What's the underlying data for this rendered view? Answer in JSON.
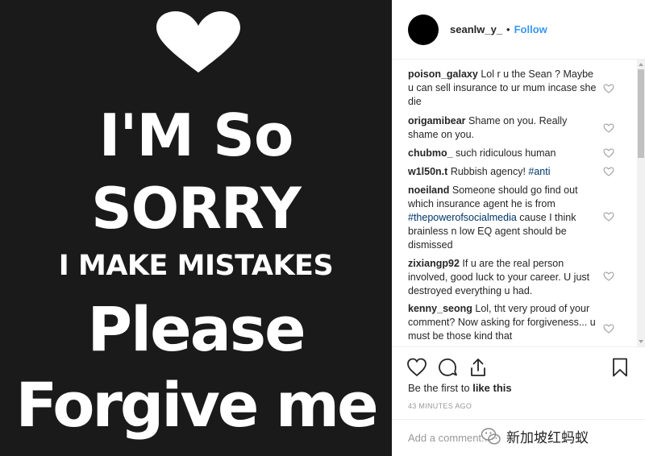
{
  "photo": {
    "lines": [
      "I'M So",
      "SORRY",
      "I MAKE MISTAKES",
      "Please",
      "Forgive me"
    ]
  },
  "header": {
    "username": "seanlw_y_",
    "separator": "•",
    "follow_label": "Follow"
  },
  "comments": [
    {
      "user": "poison_galaxy",
      "text": "Lol r u the Sean ? Maybe u can sell insurance to ur mum incase she die"
    },
    {
      "user": "origamibear",
      "text": "Shame on you. Really shame on you."
    },
    {
      "user": "chubmo_",
      "text": "such ridiculous human"
    },
    {
      "user": "w1l50n.t",
      "text": "Rubbish agency! ",
      "tag": "#anti"
    },
    {
      "user": "noeiland",
      "text": "Someone should go find out which insurance agent he is from ",
      "tag": "#thepowerofsocialmedia",
      "text_after": " cause I think brainless n low EQ agent should be dismissed"
    },
    {
      "user": "zixiangp92",
      "text": "If u are the real person involved, good luck to your career. U just destroyed everything u had."
    },
    {
      "user": "kenny_seong",
      "text": "Lol, tht very proud of your comment? Now asking for forgiveness... u must be those kind that"
    }
  ],
  "likes": {
    "prefix": "Be the first to ",
    "action": "like this"
  },
  "timestamp": "43 MINUTES AGO",
  "add_comment": {
    "placeholder": "Add a comment..."
  },
  "watermark": {
    "text": "新加坡红蚂蚁"
  },
  "icons": {
    "like": "heart-icon",
    "comment": "comment-icon",
    "share": "share-icon",
    "save": "bookmark-icon",
    "comment_like": "heart-outline-icon",
    "watermark": "wechat-icon"
  },
  "colors": {
    "photo_bg": "#1b1a1a",
    "follow": "#3897f0",
    "hashtag": "#003569",
    "muted": "#999999"
  }
}
